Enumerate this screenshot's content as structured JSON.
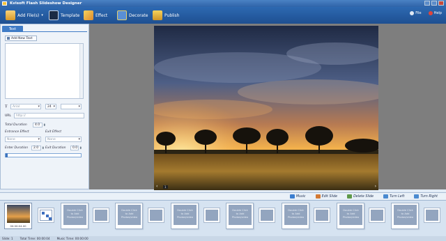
{
  "window": {
    "title": "Kvisoft Flash Slideshow Designer"
  },
  "toolbar": {
    "add_files": "Add File(s)",
    "template": "Template",
    "effect": "Effect",
    "decorate": "Decorate",
    "publish": "Publish",
    "file": "File",
    "help": "Help"
  },
  "left_panel": {
    "tab": "Text",
    "add_new_text": "Add New Text",
    "font": "Arial",
    "size": "24",
    "url_label": "URL",
    "url_value": "http://",
    "total_duration_label": "Total Duration",
    "total_duration": "4.0",
    "entrance_effect_label": "Entrance Effect",
    "exit_effect_label": "Exit Effect",
    "entrance_effect": "None",
    "exit_effect": "None",
    "enter_duration_label": "Enter Duration",
    "enter_duration": "2.0",
    "exit_duration_label": "Exit Duration",
    "exit_duration": "0.0"
  },
  "preview": {
    "page": "1",
    "prev": "‹",
    "next": "›"
  },
  "strip_toolbar": {
    "music": "Music",
    "edit_slide": "Edit Slide",
    "delete_slide": "Delete Slide",
    "turn_left": "Turn Left",
    "turn_right": "Turn Right"
  },
  "timeline": {
    "first_time": "00:00:04.00",
    "placeholder_line1": "Double Click",
    "placeholder_line2": "to Add",
    "placeholder_line3": "Photos/video"
  },
  "status": {
    "slide": "Slide: 1",
    "total_time": "Total Time: 00:00:04",
    "music_time": "Music Time: 00:00:00"
  },
  "colors": {
    "toolbar": "#2d69b1",
    "accent": "#3f7bc6",
    "placeholder": "#93a5bf"
  }
}
